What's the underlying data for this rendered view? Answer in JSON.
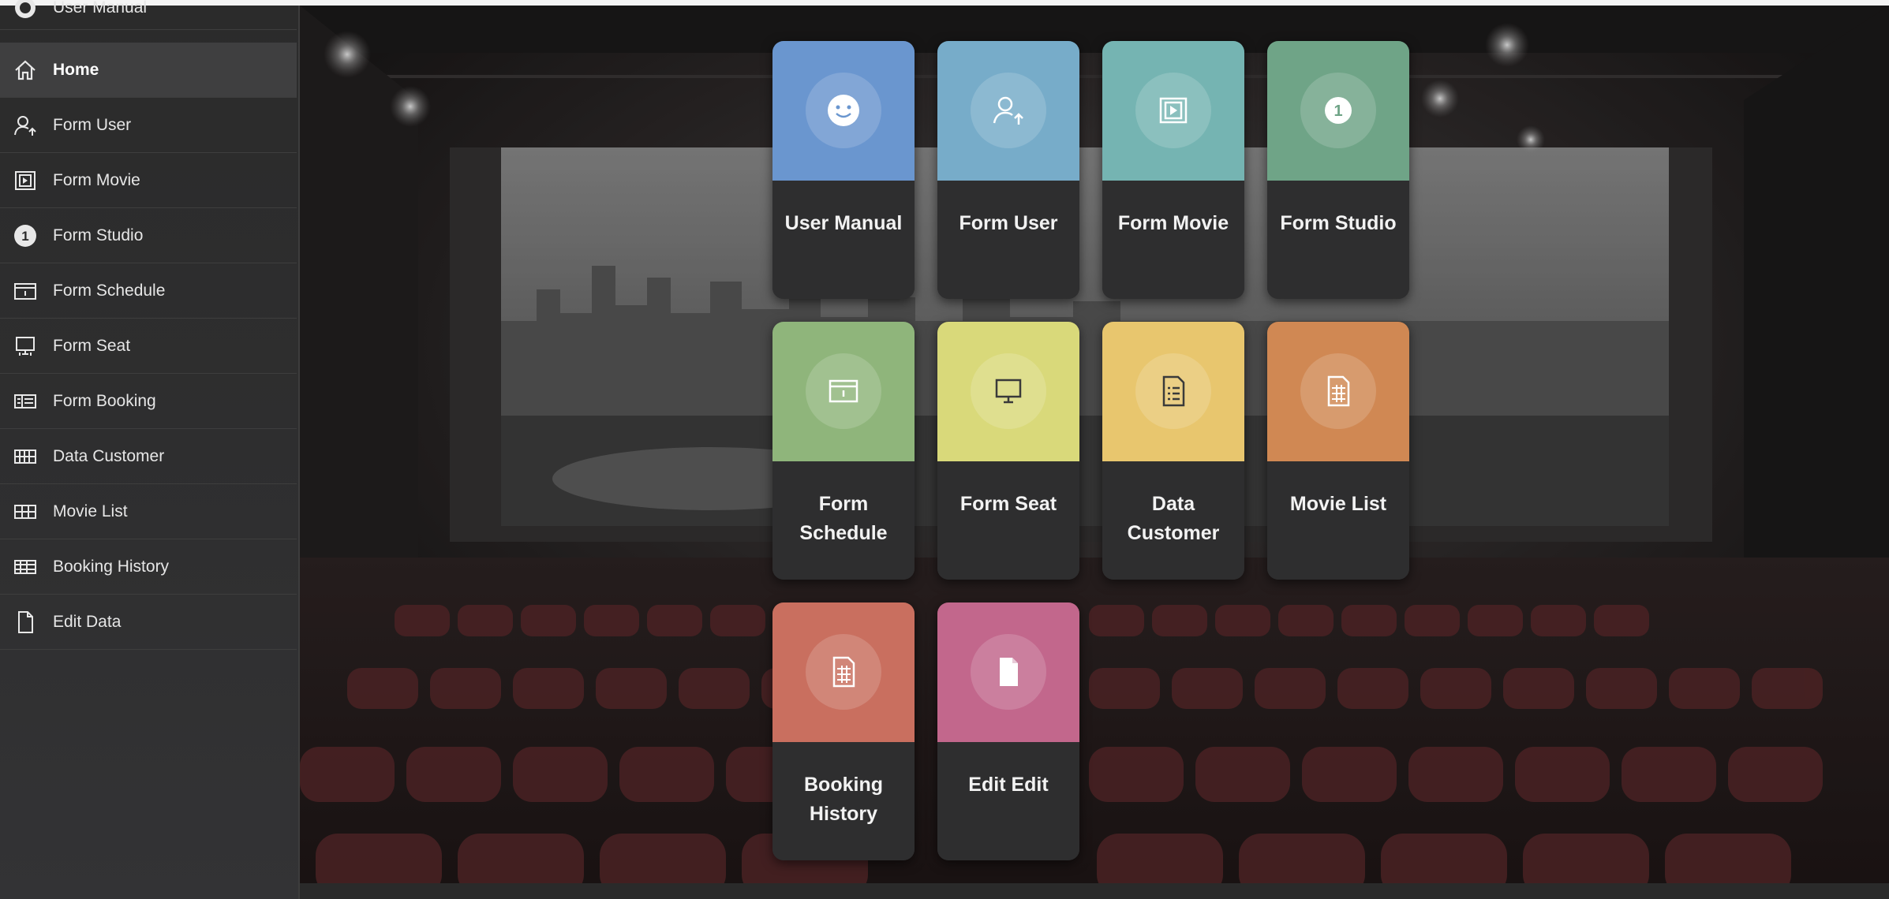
{
  "sidebar": {
    "items": [
      {
        "label": "User Manual",
        "icon": "user-manual-icon"
      },
      {
        "label": "Home",
        "icon": "home-icon"
      },
      {
        "label": "Form User",
        "icon": "user-add-icon"
      },
      {
        "label": "Form Movie",
        "icon": "movie-icon"
      },
      {
        "label": "Form Studio",
        "icon": "number-one-icon",
        "badge": "1"
      },
      {
        "label": "Form Schedule",
        "icon": "schedule-icon"
      },
      {
        "label": "Form Seat",
        "icon": "monitor-icon"
      },
      {
        "label": "Form Booking",
        "icon": "ticket-icon"
      },
      {
        "label": "Data Customer",
        "icon": "grid-data-icon"
      },
      {
        "label": "Movie List",
        "icon": "list-grid-icon"
      },
      {
        "label": "Booking History",
        "icon": "history-grid-icon"
      },
      {
        "label": "Edit Data",
        "icon": "document-icon"
      }
    ],
    "active": "Home"
  },
  "tiles": [
    {
      "label": "User Manual",
      "icon": "smiley-icon",
      "color": "#6a96cf"
    },
    {
      "label": "Form User",
      "icon": "user-add-icon",
      "color": "#77acc9"
    },
    {
      "label": "Form Movie",
      "icon": "movie-icon",
      "color": "#75b4b2"
    },
    {
      "label": "Form Studio",
      "icon": "number-one-icon",
      "badge": "1",
      "color": "#6fa487"
    },
    {
      "label": "Form Schedule",
      "icon": "schedule-icon",
      "color": "#8fb57b"
    },
    {
      "label": "Form Seat",
      "icon": "monitor-icon",
      "color": "#d9d97a"
    },
    {
      "label": "Data Customer",
      "icon": "checklist-icon",
      "color": "#e8c66e"
    },
    {
      "label": "Movie List",
      "icon": "spreadsheet-icon",
      "color": "#d08853"
    },
    {
      "label": "Booking History",
      "icon": "spreadsheet-icon",
      "color": "#c96f5f"
    },
    {
      "label": "Edit Edit",
      "icon": "document-icon",
      "color": "#c2678c"
    }
  ]
}
